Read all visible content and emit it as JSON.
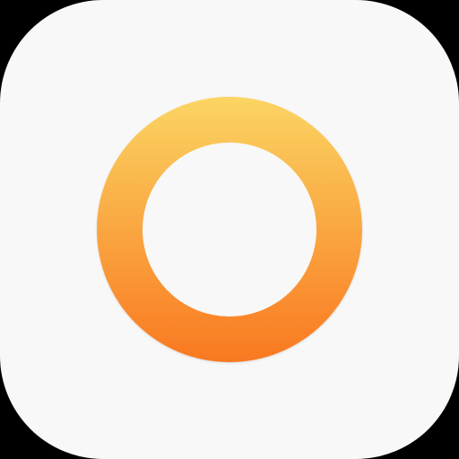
{
  "icon": {
    "name": "ring-app-icon",
    "tile_color": "#f8f8f8",
    "background_color": "#000000",
    "ring": {
      "icon_name": "ring-icon",
      "gradient_top_color": "#fbd563",
      "gradient_bottom_color": "#f97820",
      "inner_color": "#f8f8f8"
    }
  }
}
